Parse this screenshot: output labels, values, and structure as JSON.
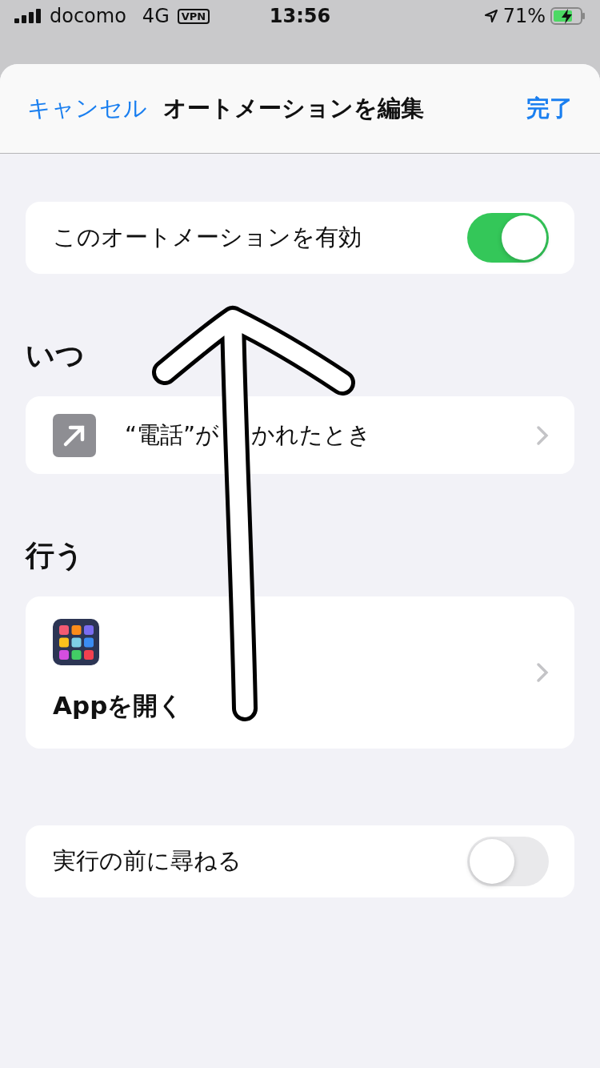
{
  "status_bar": {
    "carrier": "docomo",
    "network": "4G",
    "vpn": "VPN",
    "time": "13:56",
    "battery": "71%",
    "charging": true
  },
  "nav": {
    "cancel": "キャンセル",
    "title": "オートメーションを編集",
    "done": "完了"
  },
  "enable": {
    "label": "このオートメーションを有効",
    "on": true
  },
  "when": {
    "heading": "いつ",
    "trigger_before": "“電話”が",
    "trigger_after": "かれたとき"
  },
  "do": {
    "heading": "行う",
    "action": "Appを開く"
  },
  "ask": {
    "label": "実行の前に尋ねる",
    "on": false
  }
}
